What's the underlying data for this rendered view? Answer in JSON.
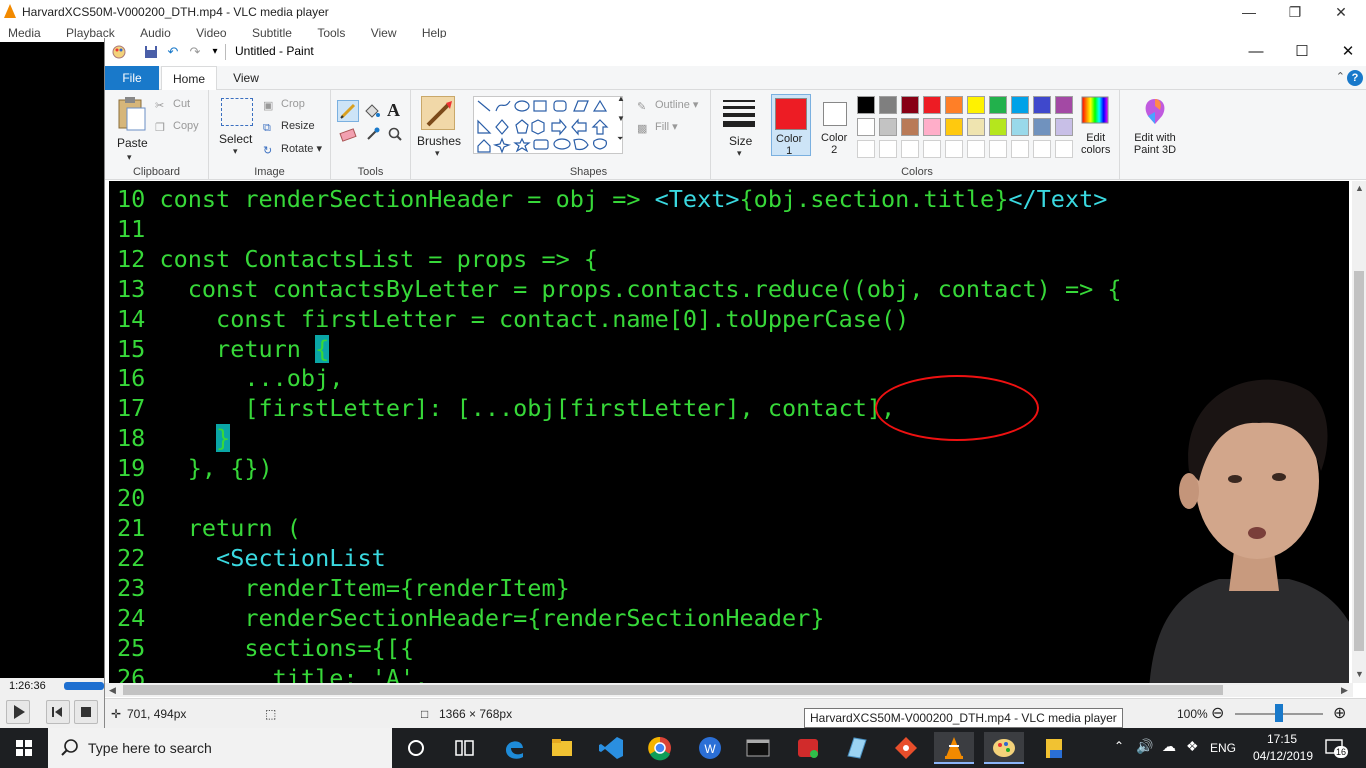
{
  "vlc": {
    "title": "HarvardXCS50M-V000200_DTH.mp4 - VLC media player",
    "menu": [
      "Media",
      "Playback",
      "Audio",
      "Video",
      "Subtitle",
      "Tools",
      "View",
      "Help"
    ],
    "time": "1:26:36"
  },
  "paint": {
    "title": "Untitled - Paint",
    "tabs": [
      "File",
      "Home",
      "View"
    ],
    "clipboard": {
      "paste": "Paste",
      "cut": "Cut",
      "copy": "Copy",
      "label": "Clipboard"
    },
    "image": {
      "select": "Select",
      "crop": "Crop",
      "resize": "Resize",
      "rotate": "Rotate",
      "label": "Image"
    },
    "tools": {
      "label": "Tools"
    },
    "brushes": {
      "label": "Brushes"
    },
    "shapes": {
      "outline": "Outline",
      "fill": "Fill",
      "label": "Shapes"
    },
    "size": {
      "label": "Size"
    },
    "colors": {
      "color1": "Color\n1",
      "color1_label": "Color",
      "color1_num": "1",
      "color2_label": "Color",
      "color2_num": "2",
      "edit": "Edit",
      "edit2": "colors",
      "label": "Colors",
      "color1_value": "#ed1c24",
      "color2_value": "#ffffff",
      "palette_row1": [
        "#000000",
        "#7f7f7f",
        "#880015",
        "#ed1c24",
        "#ff7f27",
        "#fff200",
        "#22b14c",
        "#00a2e8",
        "#3f48cc",
        "#a349a4"
      ],
      "palette_row2": [
        "#ffffff",
        "#c3c3c3",
        "#b97a57",
        "#ffaec9",
        "#ffc90e",
        "#efe4b0",
        "#b5e61d",
        "#99d9ea",
        "#7092be",
        "#c8bfe7"
      ]
    },
    "paint3d": {
      "line1": "Edit with",
      "line2": "Paint 3D"
    },
    "status": {
      "cursor": "701, 494px",
      "dimensions": "1366 × 768px",
      "zoom": "100%"
    },
    "tooltip": "HarvardXCS50M-V000200_DTH.mp4 - VLC media player"
  },
  "code": [
    {
      "n": "10",
      "indent": "",
      "parts": [
        [
          "const renderSectionHeader = obj => ",
          "g"
        ],
        [
          "<Text>",
          "c"
        ],
        [
          "{obj.section.title}",
          "g"
        ],
        [
          "</Text>",
          "c"
        ]
      ]
    },
    {
      "n": "11",
      "indent": "",
      "parts": []
    },
    {
      "n": "12",
      "indent": "",
      "parts": [
        [
          "const ContactsList = props => {",
          "g"
        ]
      ]
    },
    {
      "n": "13",
      "indent": "  ",
      "parts": [
        [
          "const contactsByLetter = props.contacts.reduce((obj, contact) => {",
          "g"
        ]
      ]
    },
    {
      "n": "14",
      "indent": "    ",
      "parts": [
        [
          "const firstLetter = contact.name[0].toUpperCase()",
          "g"
        ]
      ]
    },
    {
      "n": "15",
      "indent": "    ",
      "parts": [
        [
          "return ",
          "g"
        ],
        [
          "{",
          "cur"
        ]
      ]
    },
    {
      "n": "16",
      "indent": "      ",
      "parts": [
        [
          "...obj,",
          "g"
        ]
      ]
    },
    {
      "n": "17",
      "indent": "      ",
      "parts": [
        [
          "[firstLetter]: [...obj[firstLetter], contact],",
          "g"
        ]
      ]
    },
    {
      "n": "18",
      "indent": "    ",
      "parts": [
        [
          "}",
          "cur"
        ]
      ]
    },
    {
      "n": "19",
      "indent": "  ",
      "parts": [
        [
          "}, {})",
          "g"
        ]
      ]
    },
    {
      "n": "20",
      "indent": "",
      "parts": []
    },
    {
      "n": "21",
      "indent": "  ",
      "parts": [
        [
          "return (",
          "g"
        ]
      ]
    },
    {
      "n": "22",
      "indent": "    ",
      "parts": [
        [
          "<SectionList",
          "c"
        ]
      ]
    },
    {
      "n": "23",
      "indent": "      ",
      "parts": [
        [
          "renderItem={renderItem}",
          "g"
        ]
      ]
    },
    {
      "n": "24",
      "indent": "      ",
      "parts": [
        [
          "renderSectionHeader={renderSectionHeader}",
          "g"
        ]
      ]
    },
    {
      "n": "25",
      "indent": "      ",
      "parts": [
        [
          "sections={[{",
          "g"
        ]
      ]
    },
    {
      "n": "26",
      "indent": "        ",
      "parts": [
        [
          "title: 'A',",
          "g"
        ]
      ]
    }
  ],
  "taskbar": {
    "search_placeholder": "Type here to search",
    "lang": "ENG",
    "time": "17:15",
    "date": "04/12/2019",
    "notifications": "16"
  }
}
